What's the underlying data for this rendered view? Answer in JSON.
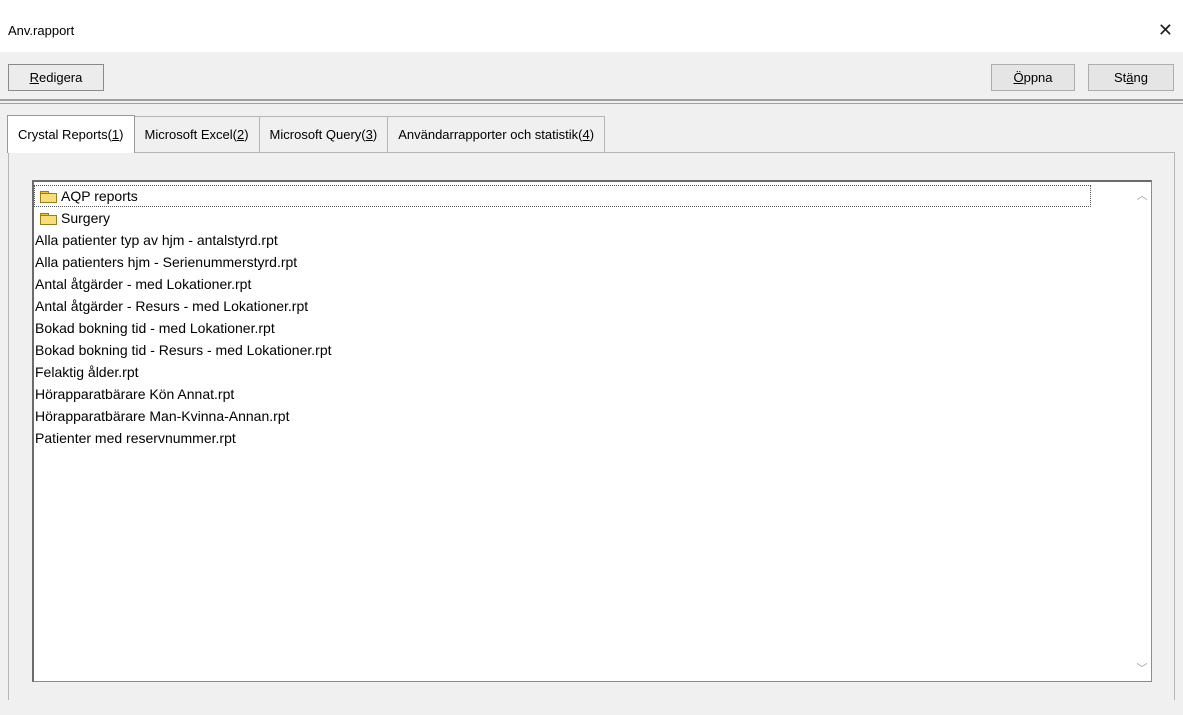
{
  "window": {
    "title": "Anv.rapport",
    "close_glyph": "✕"
  },
  "toolbar": {
    "edit_prefix": "R",
    "edit_rest": "edigera",
    "open_prefix": "Ö",
    "open_rest": "ppna",
    "close_pre": "St",
    "close_ul": "ä",
    "close_rest": "ng"
  },
  "tabs": [
    {
      "label": "Crystal Reports(",
      "key": "1",
      "suffix": ")",
      "active": true
    },
    {
      "label": "Microsoft Excel(",
      "key": "2",
      "suffix": ")",
      "active": false
    },
    {
      "label": "Microsoft Query(",
      "key": "3",
      "suffix": ")",
      "active": false
    },
    {
      "label": "Användarrapporter och statistik(",
      "key": "4",
      "suffix": ")",
      "active": false
    }
  ],
  "list": {
    "folders": [
      "AQP reports",
      "Surgery"
    ],
    "files": [
      "Alla patienter typ av hjm - antalstyrd.rpt",
      "Alla patienters hjm - Serienummerstyrd.rpt",
      "Antal åtgärder - med Lokationer.rpt",
      "Antal åtgärder - Resurs - med Lokationer.rpt",
      "Bokad bokning tid - med Lokationer.rpt",
      "Bokad bokning tid - Resurs - med Lokationer.rpt",
      "Felaktig ålder.rpt",
      "Hörapparatbärare Kön Annat.rpt",
      "Hörapparatbärare Man-Kvinna-Annan.rpt",
      "Patienter med reservnummer.rpt"
    ]
  },
  "scrollbar": {
    "up_glyph": "︿",
    "down_glyph": "﹀"
  }
}
